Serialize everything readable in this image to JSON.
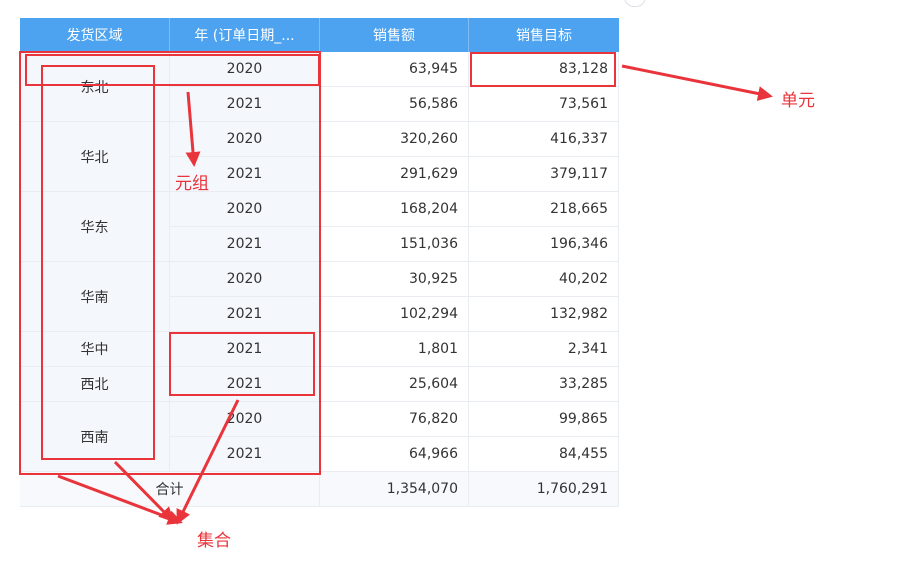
{
  "table": {
    "headers": [
      "发货区域",
      "年 (订单日期_...",
      "销售额",
      "销售目标"
    ],
    "groups": [
      {
        "region": "东北",
        "rows": [
          {
            "year": "2020",
            "sales": "63,945",
            "target": "83,128"
          },
          {
            "year": "2021",
            "sales": "56,586",
            "target": "73,561"
          }
        ]
      },
      {
        "region": "华北",
        "rows": [
          {
            "year": "2020",
            "sales": "320,260",
            "target": "416,337"
          },
          {
            "year": "2021",
            "sales": "291,629",
            "target": "379,117"
          }
        ]
      },
      {
        "region": "华东",
        "rows": [
          {
            "year": "2020",
            "sales": "168,204",
            "target": "218,665"
          },
          {
            "year": "2021",
            "sales": "151,036",
            "target": "196,346"
          }
        ]
      },
      {
        "region": "华南",
        "rows": [
          {
            "year": "2020",
            "sales": "30,925",
            "target": "40,202"
          },
          {
            "year": "2021",
            "sales": "102,294",
            "target": "132,982"
          }
        ]
      },
      {
        "region": "华中",
        "rows": [
          {
            "year": "2021",
            "sales": "1,801",
            "target": "2,341"
          }
        ]
      },
      {
        "region": "西北",
        "rows": [
          {
            "year": "2021",
            "sales": "25,604",
            "target": "33,285"
          }
        ]
      },
      {
        "region": "西南",
        "rows": [
          {
            "year": "2020",
            "sales": "76,820",
            "target": "99,865"
          },
          {
            "year": "2021",
            "sales": "64,966",
            "target": "84,455"
          }
        ]
      }
    ],
    "total": {
      "label": "合计",
      "sales": "1,354,070",
      "target": "1,760,291"
    }
  },
  "annotations": {
    "cell": "单元",
    "tuple": "元组",
    "set": "集合"
  },
  "colors": {
    "header_bg": "#4da3ef",
    "dim_bg": "#f4f8fd",
    "annotation_red": "#e8343a"
  }
}
